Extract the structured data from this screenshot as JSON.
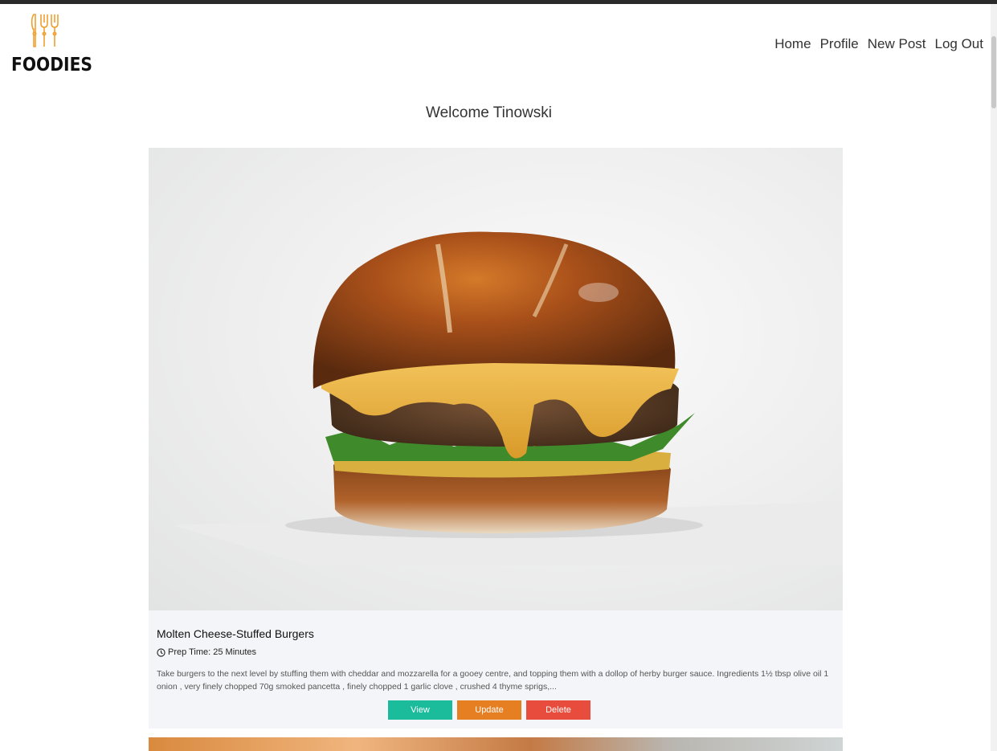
{
  "brand": {
    "name": "FOODIES",
    "icon": "utensils-icon",
    "color": "#f0a030"
  },
  "nav": {
    "items": [
      {
        "label": "Home"
      },
      {
        "label": "Profile"
      },
      {
        "label": "New Post"
      },
      {
        "label": "Log Out"
      }
    ]
  },
  "welcome": "Welcome Tinowski",
  "posts": [
    {
      "title": "Molten Cheese-Stuffed Burgers",
      "image": "burger-photo",
      "prep_label": "Prep Time: 25 Minutes",
      "description": "Take burgers to the next level by stuffing them with cheddar and mozzarella for a gooey centre, and topping them with a dollop of herby burger sauce. Ingredients 1½ tbsp olive oil 1 onion , very finely chopped 70g smoked pancetta , finely chopped 1 garlic clove , crushed 4 thyme sprigs,...",
      "buttons": {
        "view": "View",
        "update": "Update",
        "delete": "Delete"
      }
    }
  ],
  "colors": {
    "view": "#1abc9c",
    "update": "#e67e22",
    "delete": "#e74c3c",
    "card_bg": "#f4f5f8"
  }
}
